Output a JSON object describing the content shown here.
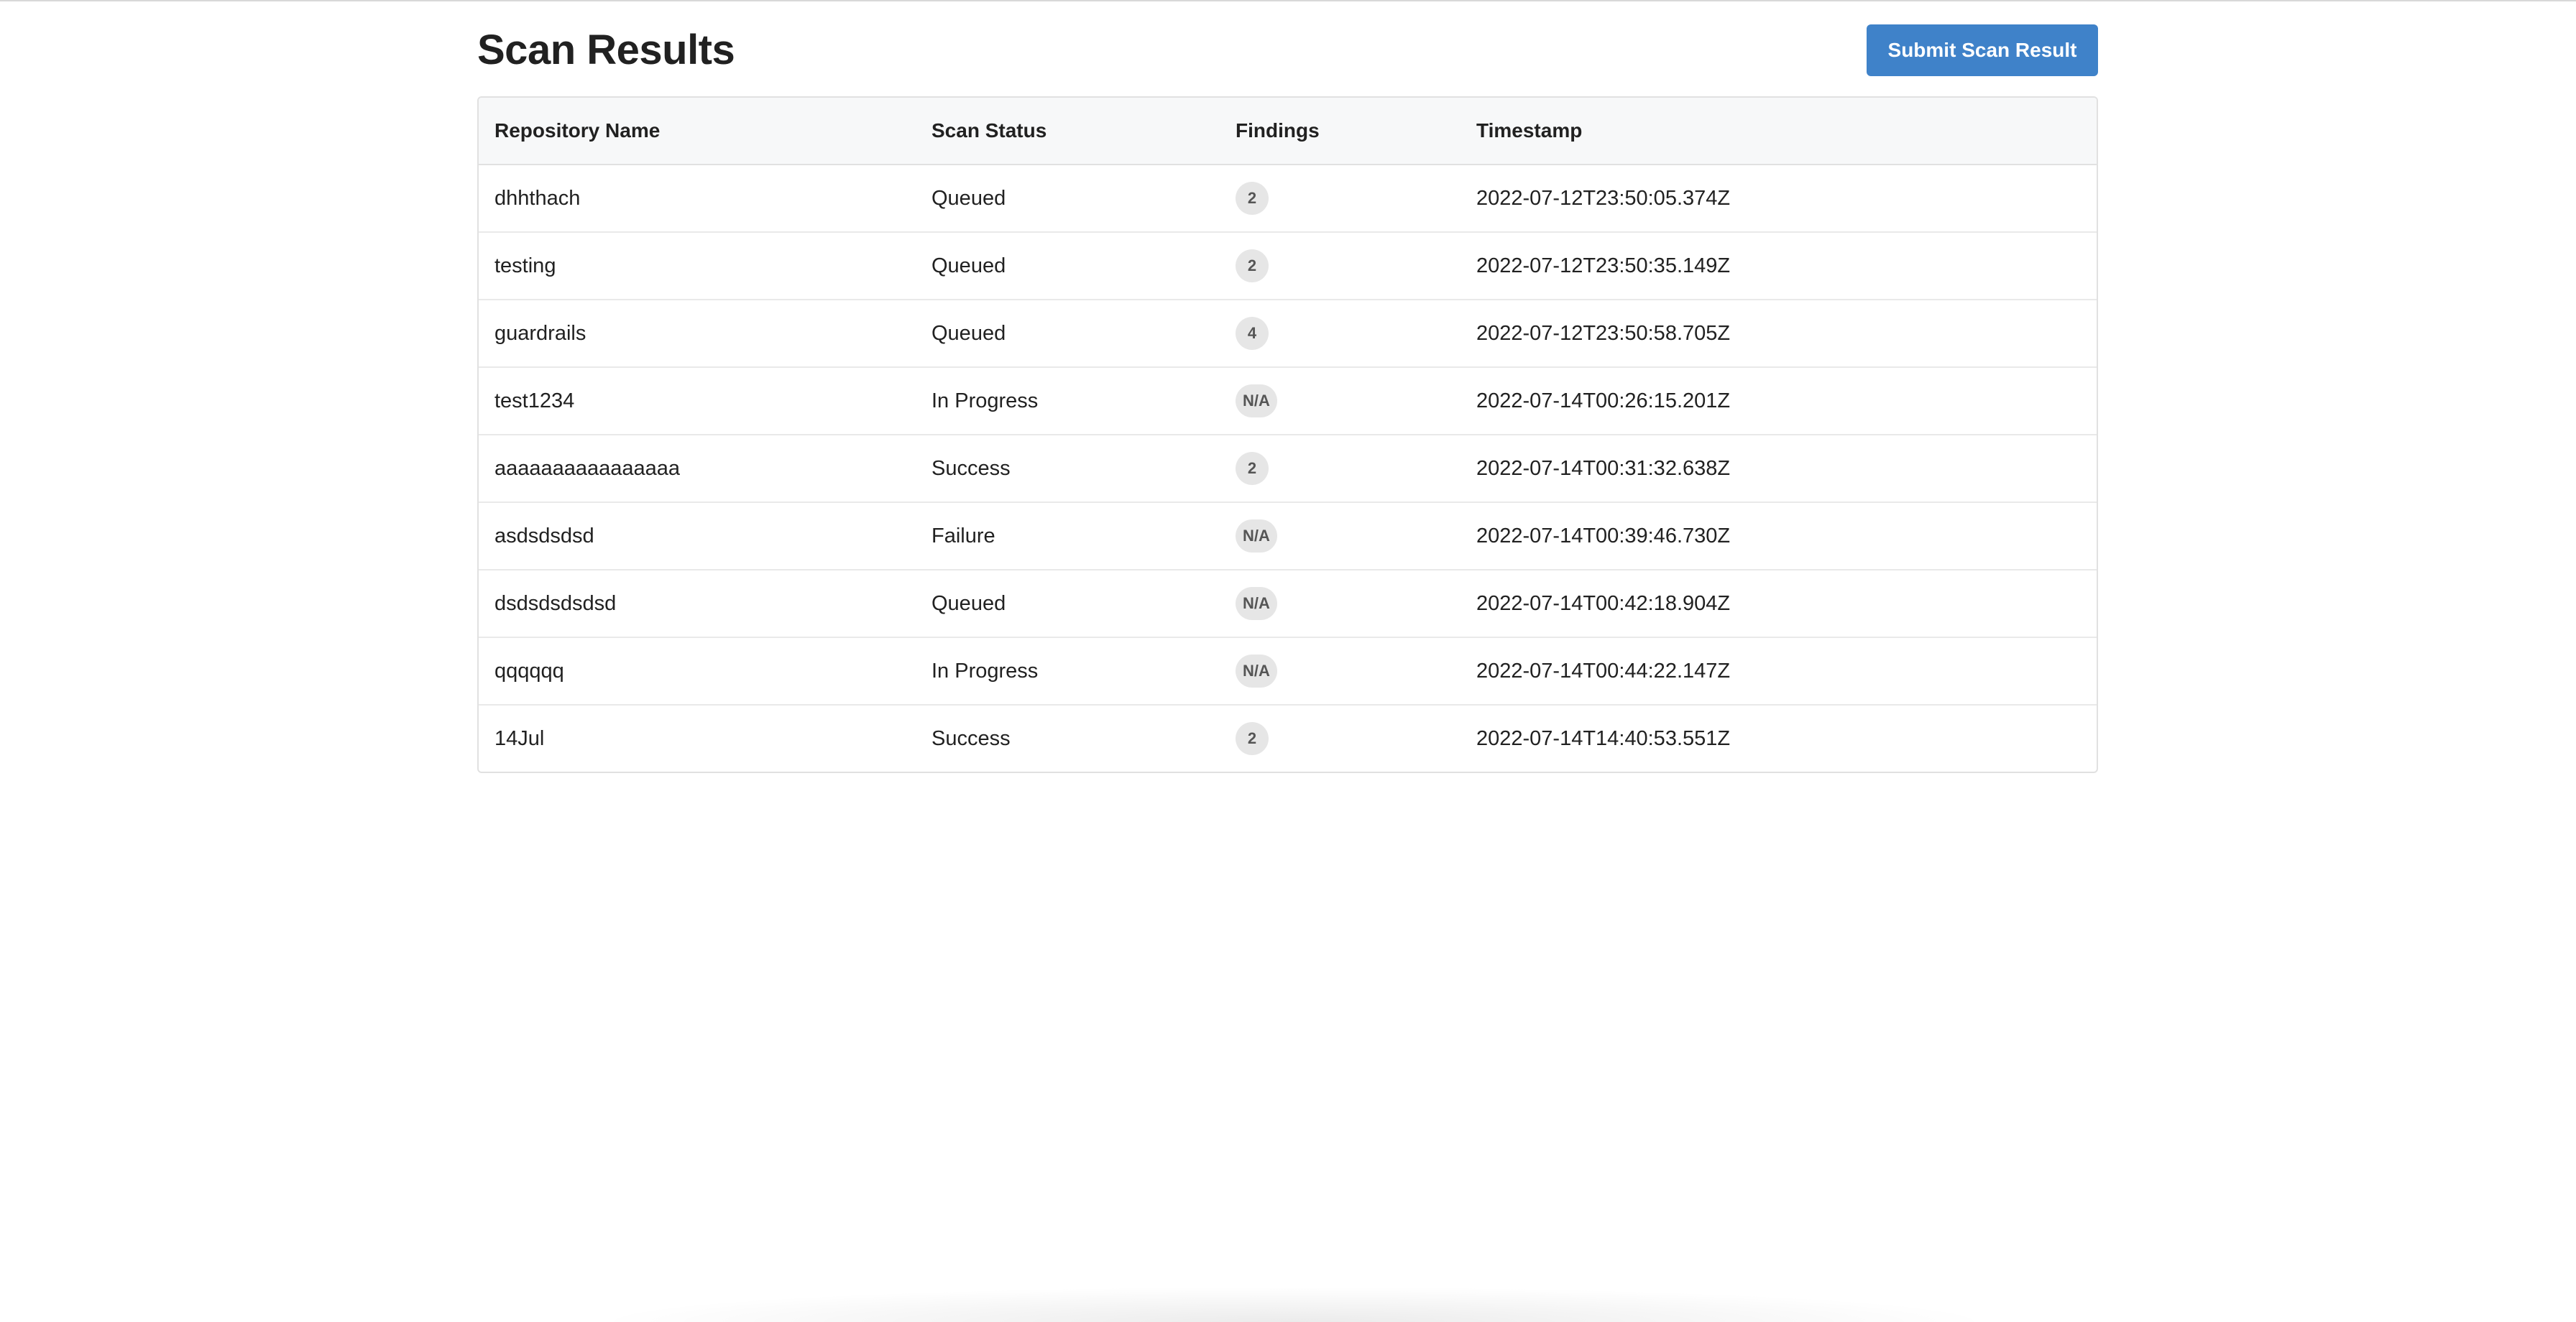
{
  "page": {
    "title": "Scan Results",
    "submit_label": "Submit Scan Result"
  },
  "colors": {
    "primary": "#3f82c9",
    "badge_bg": "#e6e6e6",
    "header_bg": "#f7f8f9"
  },
  "table": {
    "headers": [
      "Repository Name",
      "Scan Status",
      "Findings",
      "Timestamp"
    ],
    "rows": [
      {
        "repo": "dhhthach",
        "status": "Queued",
        "findings": "2",
        "timestamp": "2022-07-12T23:50:05.374Z"
      },
      {
        "repo": "testing",
        "status": "Queued",
        "findings": "2",
        "timestamp": "2022-07-12T23:50:35.149Z"
      },
      {
        "repo": "guardrails",
        "status": "Queued",
        "findings": "4",
        "timestamp": "2022-07-12T23:50:58.705Z"
      },
      {
        "repo": "test1234",
        "status": "In Progress",
        "findings": "N/A",
        "timestamp": "2022-07-14T00:26:15.201Z"
      },
      {
        "repo": "aaaaaaaaaaaaaaaa",
        "status": "Success",
        "findings": "2",
        "timestamp": "2022-07-14T00:31:32.638Z"
      },
      {
        "repo": "asdsdsdsd",
        "status": "Failure",
        "findings": "N/A",
        "timestamp": "2022-07-14T00:39:46.730Z"
      },
      {
        "repo": "dsdsdsdsdsd",
        "status": "Queued",
        "findings": "N/A",
        "timestamp": "2022-07-14T00:42:18.904Z"
      },
      {
        "repo": "qqqqqq",
        "status": "In Progress",
        "findings": "N/A",
        "timestamp": "2022-07-14T00:44:22.147Z"
      },
      {
        "repo": "14Jul",
        "status": "Success",
        "findings": "2",
        "timestamp": "2022-07-14T14:40:53.551Z"
      }
    ]
  }
}
